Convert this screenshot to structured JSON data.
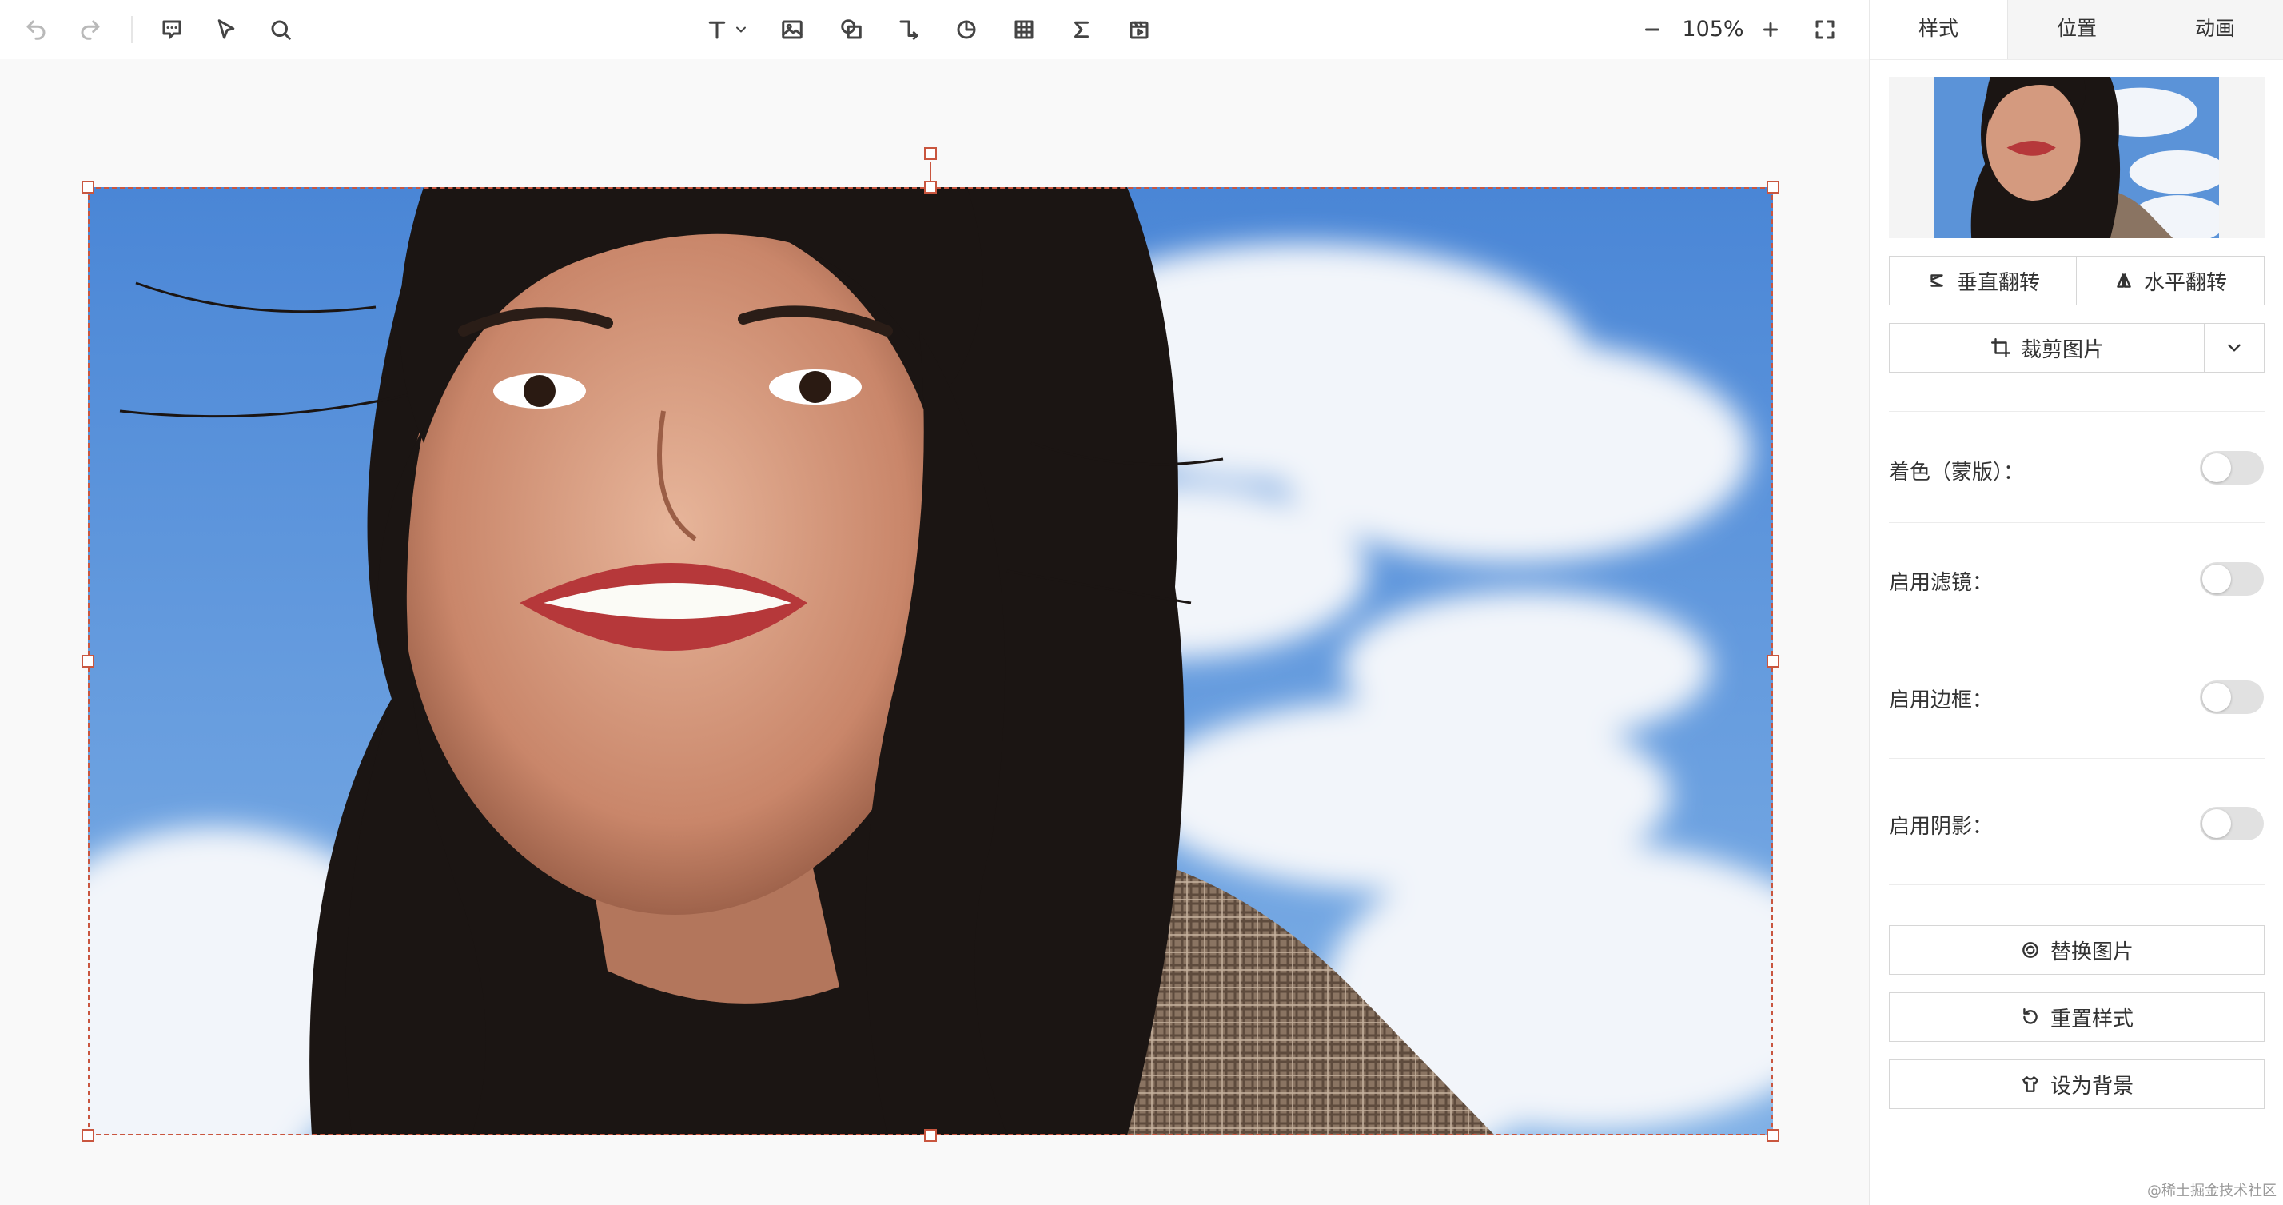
{
  "toolbar": {
    "tools": [
      {
        "name": "undo-icon",
        "enabled": false
      },
      {
        "name": "redo-icon",
        "enabled": false
      },
      {
        "name": "comment-icon",
        "enabled": true
      },
      {
        "name": "pointer-icon",
        "enabled": true
      },
      {
        "name": "search-icon",
        "enabled": true
      },
      {
        "name": "text-icon",
        "enabled": true
      },
      {
        "name": "image-icon",
        "enabled": true
      },
      {
        "name": "shape-icon",
        "enabled": true
      },
      {
        "name": "connector-icon",
        "enabled": true
      },
      {
        "name": "chart-icon",
        "enabled": true
      },
      {
        "name": "table-icon",
        "enabled": true
      },
      {
        "name": "formula-icon",
        "enabled": true
      },
      {
        "name": "media-icon",
        "enabled": true
      },
      {
        "name": "zoom-out-icon",
        "enabled": true
      },
      {
        "name": "zoom-in-icon",
        "enabled": true
      },
      {
        "name": "fullscreen-icon",
        "enabled": true
      }
    ],
    "zoom": "105%"
  },
  "panel": {
    "tabs": [
      {
        "label": "样式",
        "active": true
      },
      {
        "label": "位置",
        "active": false
      },
      {
        "label": "动画",
        "active": false
      }
    ],
    "flip_vertical": "垂直翻转",
    "flip_horizontal": "水平翻转",
    "crop": "裁剪图片",
    "options": [
      {
        "label": "着色（蒙版）：",
        "enabled": false
      },
      {
        "label": "启用滤镜：",
        "enabled": false
      },
      {
        "label": "启用边框：",
        "enabled": false
      },
      {
        "label": "启用阴影：",
        "enabled": false
      }
    ],
    "replace_image": "替换图片",
    "reset_style": "重置样式",
    "set_background": "设为背景"
  },
  "colors": {
    "selection": "#c9563f",
    "sky": "#5b93d8",
    "toggle_off": "#e1e1e1"
  },
  "watermark": "@稀土掘金技术社区"
}
